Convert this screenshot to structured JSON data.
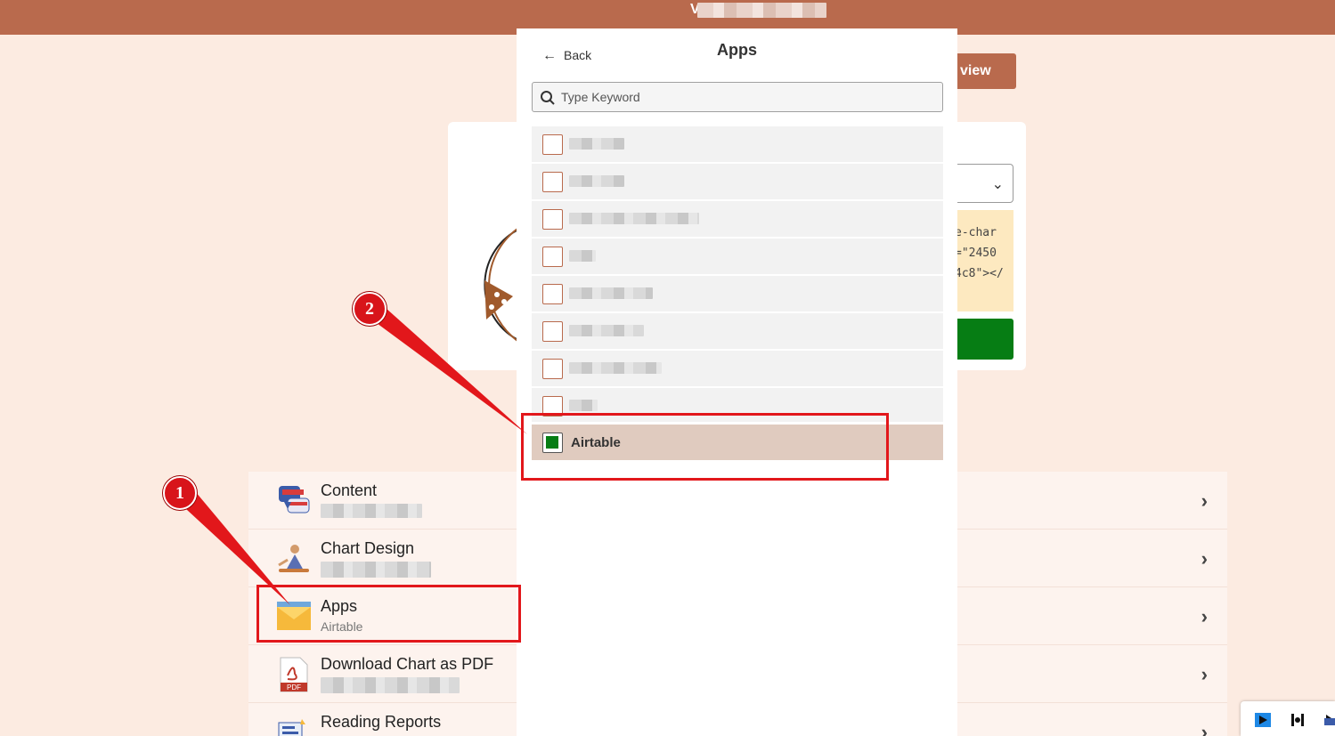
{
  "topbar": {
    "title_initial": "V"
  },
  "header": {
    "preview_label": "view"
  },
  "background_card": {
    "code_lines": [
      "e-char",
      "=\"2450",
      "4c8\"></"
    ]
  },
  "panel": {
    "back_label": "Back",
    "title": "Apps",
    "search": {
      "placeholder": "Type Keyword",
      "value": ""
    },
    "apps": [
      {
        "label": "",
        "checked": false
      },
      {
        "label": "",
        "checked": false
      },
      {
        "label": "",
        "checked": false
      },
      {
        "label": "",
        "checked": false
      },
      {
        "label": "",
        "checked": false
      },
      {
        "label": "",
        "checked": false
      },
      {
        "label": "",
        "checked": false
      },
      {
        "label": "",
        "checked": false
      },
      {
        "label": "Airtable",
        "checked": true
      }
    ]
  },
  "menu": {
    "items": [
      {
        "label": "Content",
        "sub": ""
      },
      {
        "label": "Chart Design",
        "sub": ""
      },
      {
        "label": "Apps",
        "sub": "Airtable"
      },
      {
        "label": "Download Chart as PDF",
        "sub": ""
      },
      {
        "label": "Reading Reports",
        "sub": ""
      }
    ]
  },
  "annotations": {
    "badge_1": "1",
    "badge_2": "2"
  },
  "colors": {
    "brand": "#b96a4d",
    "accent_green": "#067d14",
    "highlight": "#e2171b",
    "background": "#fcebe1"
  }
}
